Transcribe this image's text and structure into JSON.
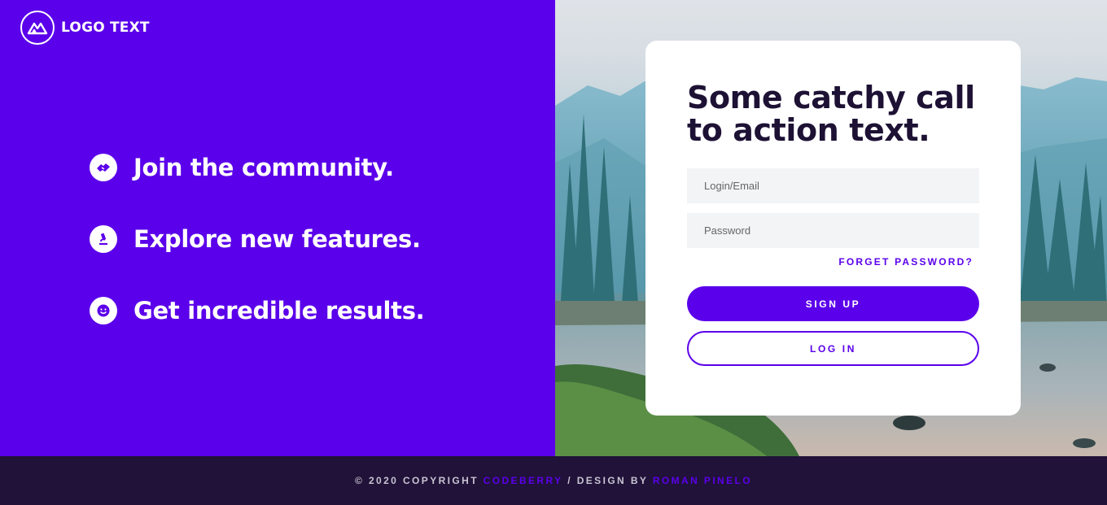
{
  "logo": {
    "text": "LOGO TEXT",
    "icon": "mountain-logo-icon"
  },
  "features": [
    {
      "icon": "handshake-icon",
      "label": "Join the community."
    },
    {
      "icon": "microscope-icon",
      "label": "Explore new features."
    },
    {
      "icon": "smile-icon",
      "label": "Get incredible results."
    }
  ],
  "card": {
    "title": "Some catchy call to action text.",
    "login_placeholder": "Login/Email",
    "password_placeholder": "Password",
    "forget_label": "FORGET PASSWORD?",
    "signup_label": "SIGN UP",
    "login_label": "LOG IN"
  },
  "footer": {
    "prefix": "© 2020 COPYRIGHT ",
    "brand": "CODEBERRY",
    "middle": " / DESIGN BY ",
    "designer": "ROMAN PINELO"
  },
  "colors": {
    "primary": "#5b00ea",
    "dark": "#201238",
    "title": "#1d1134"
  }
}
